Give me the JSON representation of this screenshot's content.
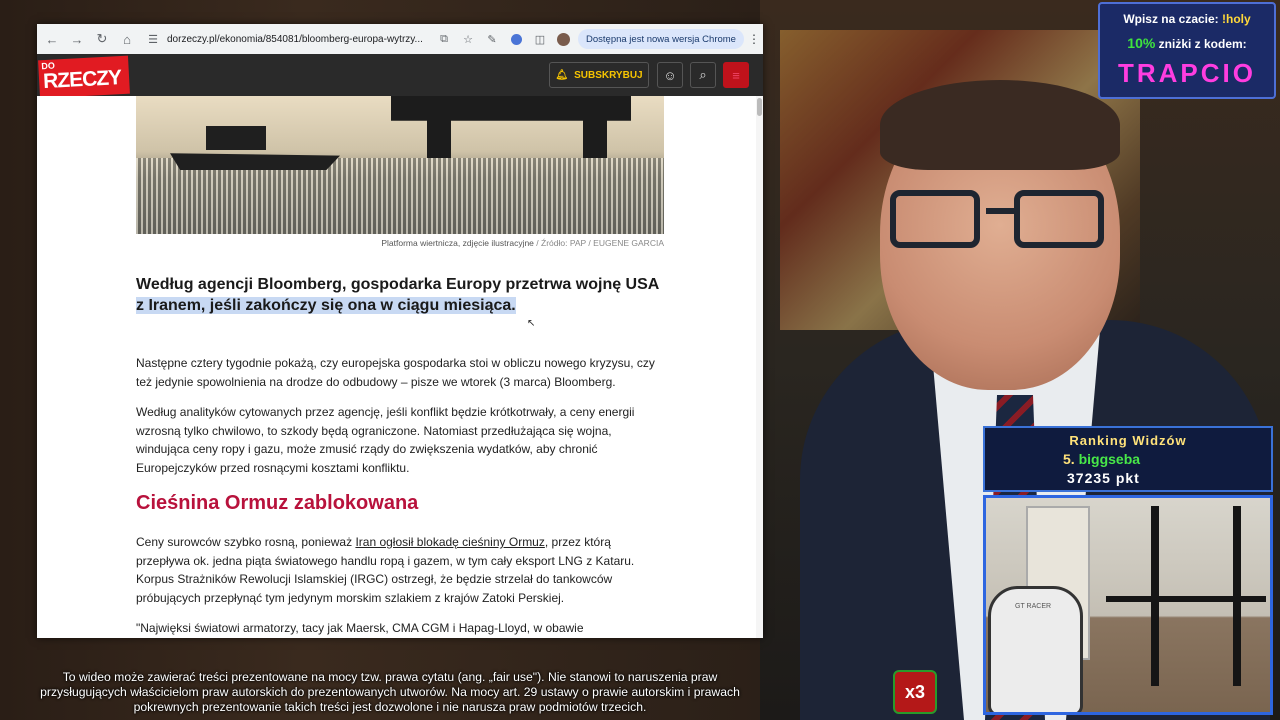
{
  "browser": {
    "url": "dorzeczy.pl/ekonomia/854081/bloomberg-europa-wytrzy...",
    "update_notice": "Dostępna jest nowa wersja Chrome",
    "icons": [
      "back-icon",
      "forward-icon",
      "reload-icon",
      "home-icon",
      "site-info-icon",
      "install-icon",
      "bookmark-star-icon",
      "extension-icon",
      "extensions-puzzle-icon",
      "profile-avatar",
      "more-icon"
    ]
  },
  "site": {
    "logo_top": "DO",
    "logo_main": "RZECZY",
    "subscribe_label": "SUBSKRYBUJ",
    "accent_color": "#e11b22"
  },
  "article": {
    "image_caption": "Platforma wiertnicza, zdjęcie ilustracyjne",
    "image_source": "/ Źródło: PAP / EUGENE GARCIA",
    "lead_part1": "Według agencji Bloomberg, gospodarka Europy przetrwa wojnę USA ",
    "lead_highlight": "z Iranem, jeśli zakończy się ona w ciągu miesiąca.",
    "p1": "Następne cztery tygodnie pokażą, czy europejska gospodarka stoi w obliczu nowego kryzysu, czy też jedynie spowolnienia na drodze do odbudowy – pisze we wtorek (3 marca) Bloomberg.",
    "p2": "Według analityków cytowanych przez agencję, jeśli konflikt będzie krótkotrwały, a ceny energii wzrosną tylko chwilowo, to szkody będą ograniczone. Natomiast przedłużająca się wojna, windująca ceny ropy i gazu, może zmusić rządy do zwiększenia wydatków, aby chronić Europejczyków przed rosnącymi kosztami konfliktu.",
    "subheading": "Cieśnina Ormuz zablokowana",
    "p3_before": "Ceny surowców szybko rosną, ponieważ ",
    "p3_link": "Iran ogłosił blokadę cieśniny Ormuz",
    "p3_after": ", przez którą przepływa ok. jedna piąta światowego handlu ropą i gazem, w tym cały eksport LNG z Kataru. Korpus Strażników Rewolucji Islamskiej (IRGC) ostrzegł, że będzie strzelał do tankowców próbujących przepłynąć tym jedynym morskim szlakiem z krajów Zatoki Perskiej.",
    "p4": "\"Najwięksi światowi armatorzy, tacy jak Maersk, CMA CGM i Hapag-Lloyd, w obawie"
  },
  "promo": {
    "line1_prefix": "Wpisz na czacie: ",
    "line1_command": "!holy",
    "line2_percent": "10%",
    "line2_rest": " zniżki z kodem:",
    "code": "TRAPCIO"
  },
  "ranking": {
    "title": "Ranking Widzów",
    "position": "5.",
    "user": "biggseba",
    "points": "37235 pkt"
  },
  "webcam": {
    "chair_brand": "GT RACER"
  },
  "bot_badge": "x3",
  "disclaimer": "To wideo może zawierać treści prezentowane na mocy tzw. prawa cytatu (ang. „fair use\"). Nie stanowi to naruszenia praw przysługujących właścicielom praw autorskich do prezentowanych utworów. Na mocy art. 29 ustawy o prawie autorskim i prawach pokrewnych prezentowanie takich treści jest dozwolone i nie narusza praw podmiotów trzecich."
}
